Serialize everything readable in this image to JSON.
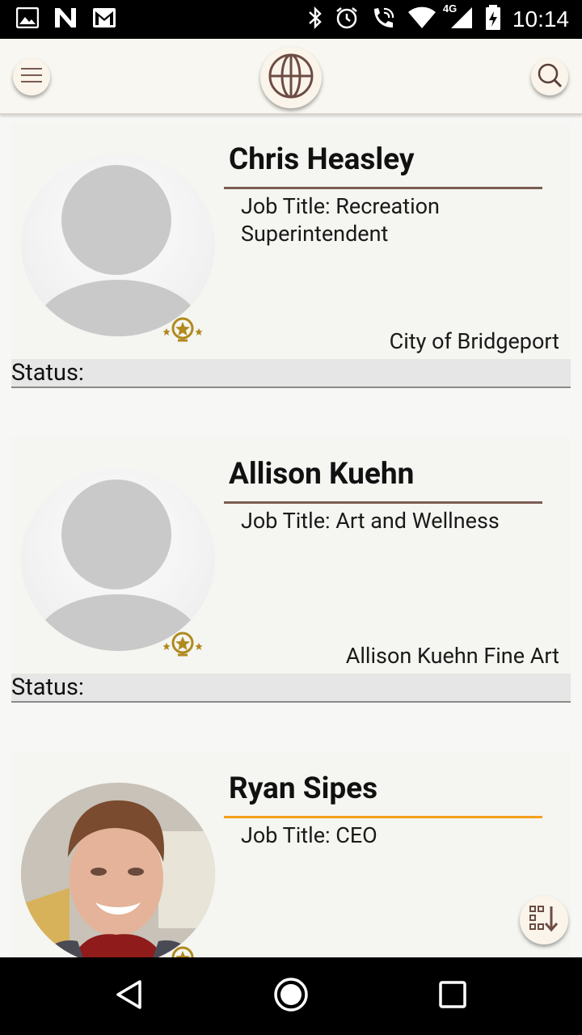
{
  "status_bar": {
    "time": "10:14",
    "network": "4G",
    "left_icons": [
      "image-icon",
      "n-app-icon",
      "gmail-icon"
    ],
    "right_icons": [
      "bluetooth-icon",
      "alarm-icon",
      "wifi-call-icon",
      "wifi-icon",
      "signal-icon",
      "battery-charging-icon"
    ]
  },
  "app_bar": {
    "menu_icon": "hamburger-icon",
    "logo_icon": "globe-icon",
    "search_icon": "search-icon"
  },
  "cards": [
    {
      "name": "Chris Heasley",
      "job": "Job Title: Recreation Superintendent",
      "org": "City of Bridgeport",
      "status": "Status:",
      "rule_color": "#7a5c51",
      "photo": "placeholder"
    },
    {
      "name": "Allison Kuehn",
      "job": "Job Title: Art and Wellness",
      "org": "Allison Kuehn Fine Art",
      "status": "Status:",
      "rule_color": "#7a5c51",
      "photo": "placeholder"
    },
    {
      "name": "Ryan Sipes",
      "job": "Job Title: CEO",
      "org": "",
      "status": "",
      "rule_color": "#f4a11d",
      "photo": "profile-photo"
    }
  ],
  "fab": {
    "icon": "sort-descending-icon"
  },
  "nav_bar": {
    "back_icon": "back-icon",
    "home_icon": "home-icon",
    "recents_icon": "recents-icon"
  },
  "colors": {
    "accent_brown": "#7a5c51",
    "accent_orange": "#f4a11d",
    "badge_gold": "#b08a1e",
    "background": "#f7f7f5"
  }
}
